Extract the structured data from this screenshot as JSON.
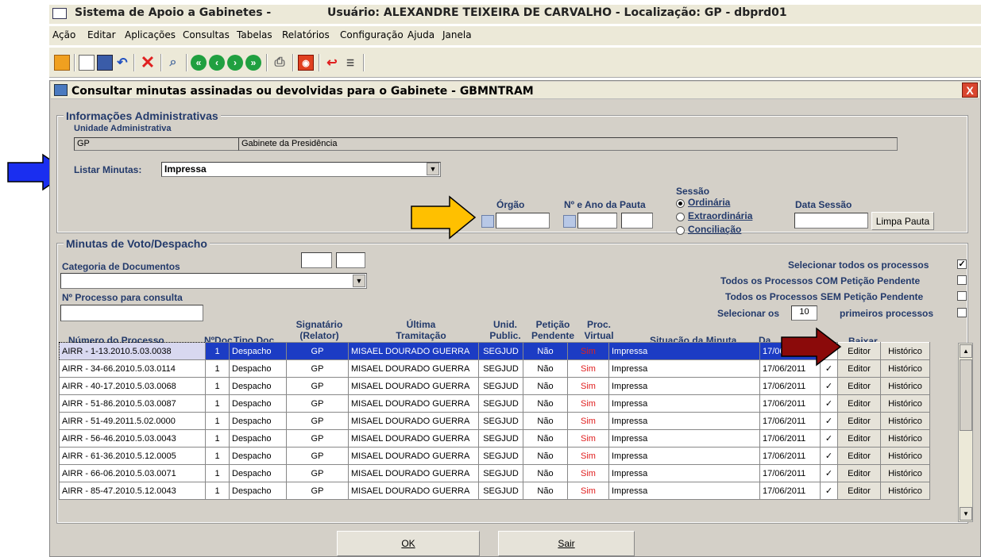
{
  "app": {
    "title": "Sistema de Apoio a Gabinetes -",
    "user_info": "Usuário: ALEXANDRE TEIXEIRA DE CARVALHO - Localização: GP - dbprd01"
  },
  "menu": [
    "Ação",
    "Editar",
    "Aplicações",
    "Consultas",
    "Tabelas",
    "Relatórios",
    "Configuração",
    "Ajuda",
    "Janela"
  ],
  "window": {
    "title": "Consultar minutas assinadas ou devolvidas para o Gabinete - GBMNTRAM",
    "close": "X"
  },
  "info": {
    "legend": "Informações Administrativas",
    "unidade_label": "Unidade Administrativa",
    "unidade_code": "GP",
    "unidade_name": "Gabinete da Presidência",
    "listar_label": "Listar Minutas:",
    "listar_value": "Impressa"
  },
  "pauta": {
    "orgao_label": "Órgão",
    "numero_label": "Nº e Ano da Pauta",
    "sessao_label": "Sessão",
    "sessao_options": [
      "Ordinária",
      "Extraordinária",
      "Conciliação"
    ],
    "data_sessao_label": "Data Sessão",
    "limpa_button": "Limpa Pauta"
  },
  "minutas": {
    "legend": "Minutas de Voto/Despacho",
    "categoria_label": "Categoria de Documentos",
    "processo_label": "Nº Processo para consulta",
    "sel_todos": "Selecionar todos os processos",
    "com_peticao": "Todos os Processos COM Petição Pendente",
    "sem_peticao": "Todos os Processos SEM Petição Pendente",
    "selecionar_os": "Selecionar os",
    "selecionar_n": "10",
    "primeiros": "primeiros processos"
  },
  "columns": {
    "numero": "Número do Processo",
    "ndoc": "NºDoc",
    "tipo": "Tipo Doc.",
    "signatario": "Signatário\n(Relator)",
    "ultima": "Última\nTramitação",
    "unid": "Unid.\nPublic.",
    "peticao": "Petição\nPendente",
    "proc": "Proc.\nVirtual",
    "situacao": "Situação da Minuta",
    "data": "Da",
    "baixar": "Baixar"
  },
  "rows": [
    {
      "numero": "AIRR - 1-13.2010.5.03.0038",
      "ndoc": "1",
      "tipo": "Despacho",
      "sig": "GP",
      "tram": "MISAEL DOURADO GUERRA",
      "unid": "SEGJUD",
      "pet": "Não",
      "virt": "Sim",
      "sit": "Impressa",
      "data": "17/06/2011",
      "checked": "✓",
      "editor": "Editor",
      "hist": "Histórico"
    },
    {
      "numero": "AIRR - 34-66.2010.5.03.0114",
      "ndoc": "1",
      "tipo": "Despacho",
      "sig": "GP",
      "tram": "MISAEL DOURADO GUERRA",
      "unid": "SEGJUD",
      "pet": "Não",
      "virt": "Sim",
      "sit": "Impressa",
      "data": "17/06/2011",
      "checked": "✓",
      "editor": "Editor",
      "hist": "Histórico"
    },
    {
      "numero": "AIRR - 40-17.2010.5.03.0068",
      "ndoc": "1",
      "tipo": "Despacho",
      "sig": "GP",
      "tram": "MISAEL DOURADO GUERRA",
      "unid": "SEGJUD",
      "pet": "Não",
      "virt": "Sim",
      "sit": "Impressa",
      "data": "17/06/2011",
      "checked": "✓",
      "editor": "Editor",
      "hist": "Histórico"
    },
    {
      "numero": "AIRR - 51-86.2010.5.03.0087",
      "ndoc": "1",
      "tipo": "Despacho",
      "sig": "GP",
      "tram": "MISAEL DOURADO GUERRA",
      "unid": "SEGJUD",
      "pet": "Não",
      "virt": "Sim",
      "sit": "Impressa",
      "data": "17/06/2011",
      "checked": "✓",
      "editor": "Editor",
      "hist": "Histórico"
    },
    {
      "numero": "AIRR - 51-49.2011.5.02.0000",
      "ndoc": "1",
      "tipo": "Despacho",
      "sig": "GP",
      "tram": "MISAEL DOURADO GUERRA",
      "unid": "SEGJUD",
      "pet": "Não",
      "virt": "Sim",
      "sit": "Impressa",
      "data": "17/06/2011",
      "checked": "✓",
      "editor": "Editor",
      "hist": "Histórico"
    },
    {
      "numero": "AIRR - 56-46.2010.5.03.0043",
      "ndoc": "1",
      "tipo": "Despacho",
      "sig": "GP",
      "tram": "MISAEL DOURADO GUERRA",
      "unid": "SEGJUD",
      "pet": "Não",
      "virt": "Sim",
      "sit": "Impressa",
      "data": "17/06/2011",
      "checked": "✓",
      "editor": "Editor",
      "hist": "Histórico"
    },
    {
      "numero": "AIRR - 61-36.2010.5.12.0005",
      "ndoc": "1",
      "tipo": "Despacho",
      "sig": "GP",
      "tram": "MISAEL DOURADO GUERRA",
      "unid": "SEGJUD",
      "pet": "Não",
      "virt": "Sim",
      "sit": "Impressa",
      "data": "17/06/2011",
      "checked": "✓",
      "editor": "Editor",
      "hist": "Histórico"
    },
    {
      "numero": "AIRR - 66-06.2010.5.03.0071",
      "ndoc": "1",
      "tipo": "Despacho",
      "sig": "GP",
      "tram": "MISAEL DOURADO GUERRA",
      "unid": "SEGJUD",
      "pet": "Não",
      "virt": "Sim",
      "sit": "Impressa",
      "data": "17/06/2011",
      "checked": "✓",
      "editor": "Editor",
      "hist": "Histórico"
    },
    {
      "numero": "AIRR - 85-47.2010.5.12.0043",
      "ndoc": "1",
      "tipo": "Despacho",
      "sig": "GP",
      "tram": "MISAEL DOURADO GUERRA",
      "unid": "SEGJUD",
      "pet": "Não",
      "virt": "Sim",
      "sit": "Impressa",
      "data": "17/06/2011",
      "checked": "✓",
      "editor": "Editor",
      "hist": "Histórico"
    }
  ],
  "footer": {
    "ok": "OK",
    "sair": "Sair"
  },
  "colors": {
    "selected_row": "#1c3cc4",
    "sim": "#e02020",
    "label": "#233a6b",
    "arrow_blue": "#1a2ef0",
    "arrow_yellow": "#ffc000",
    "arrow_red": "#8b0a0a"
  }
}
